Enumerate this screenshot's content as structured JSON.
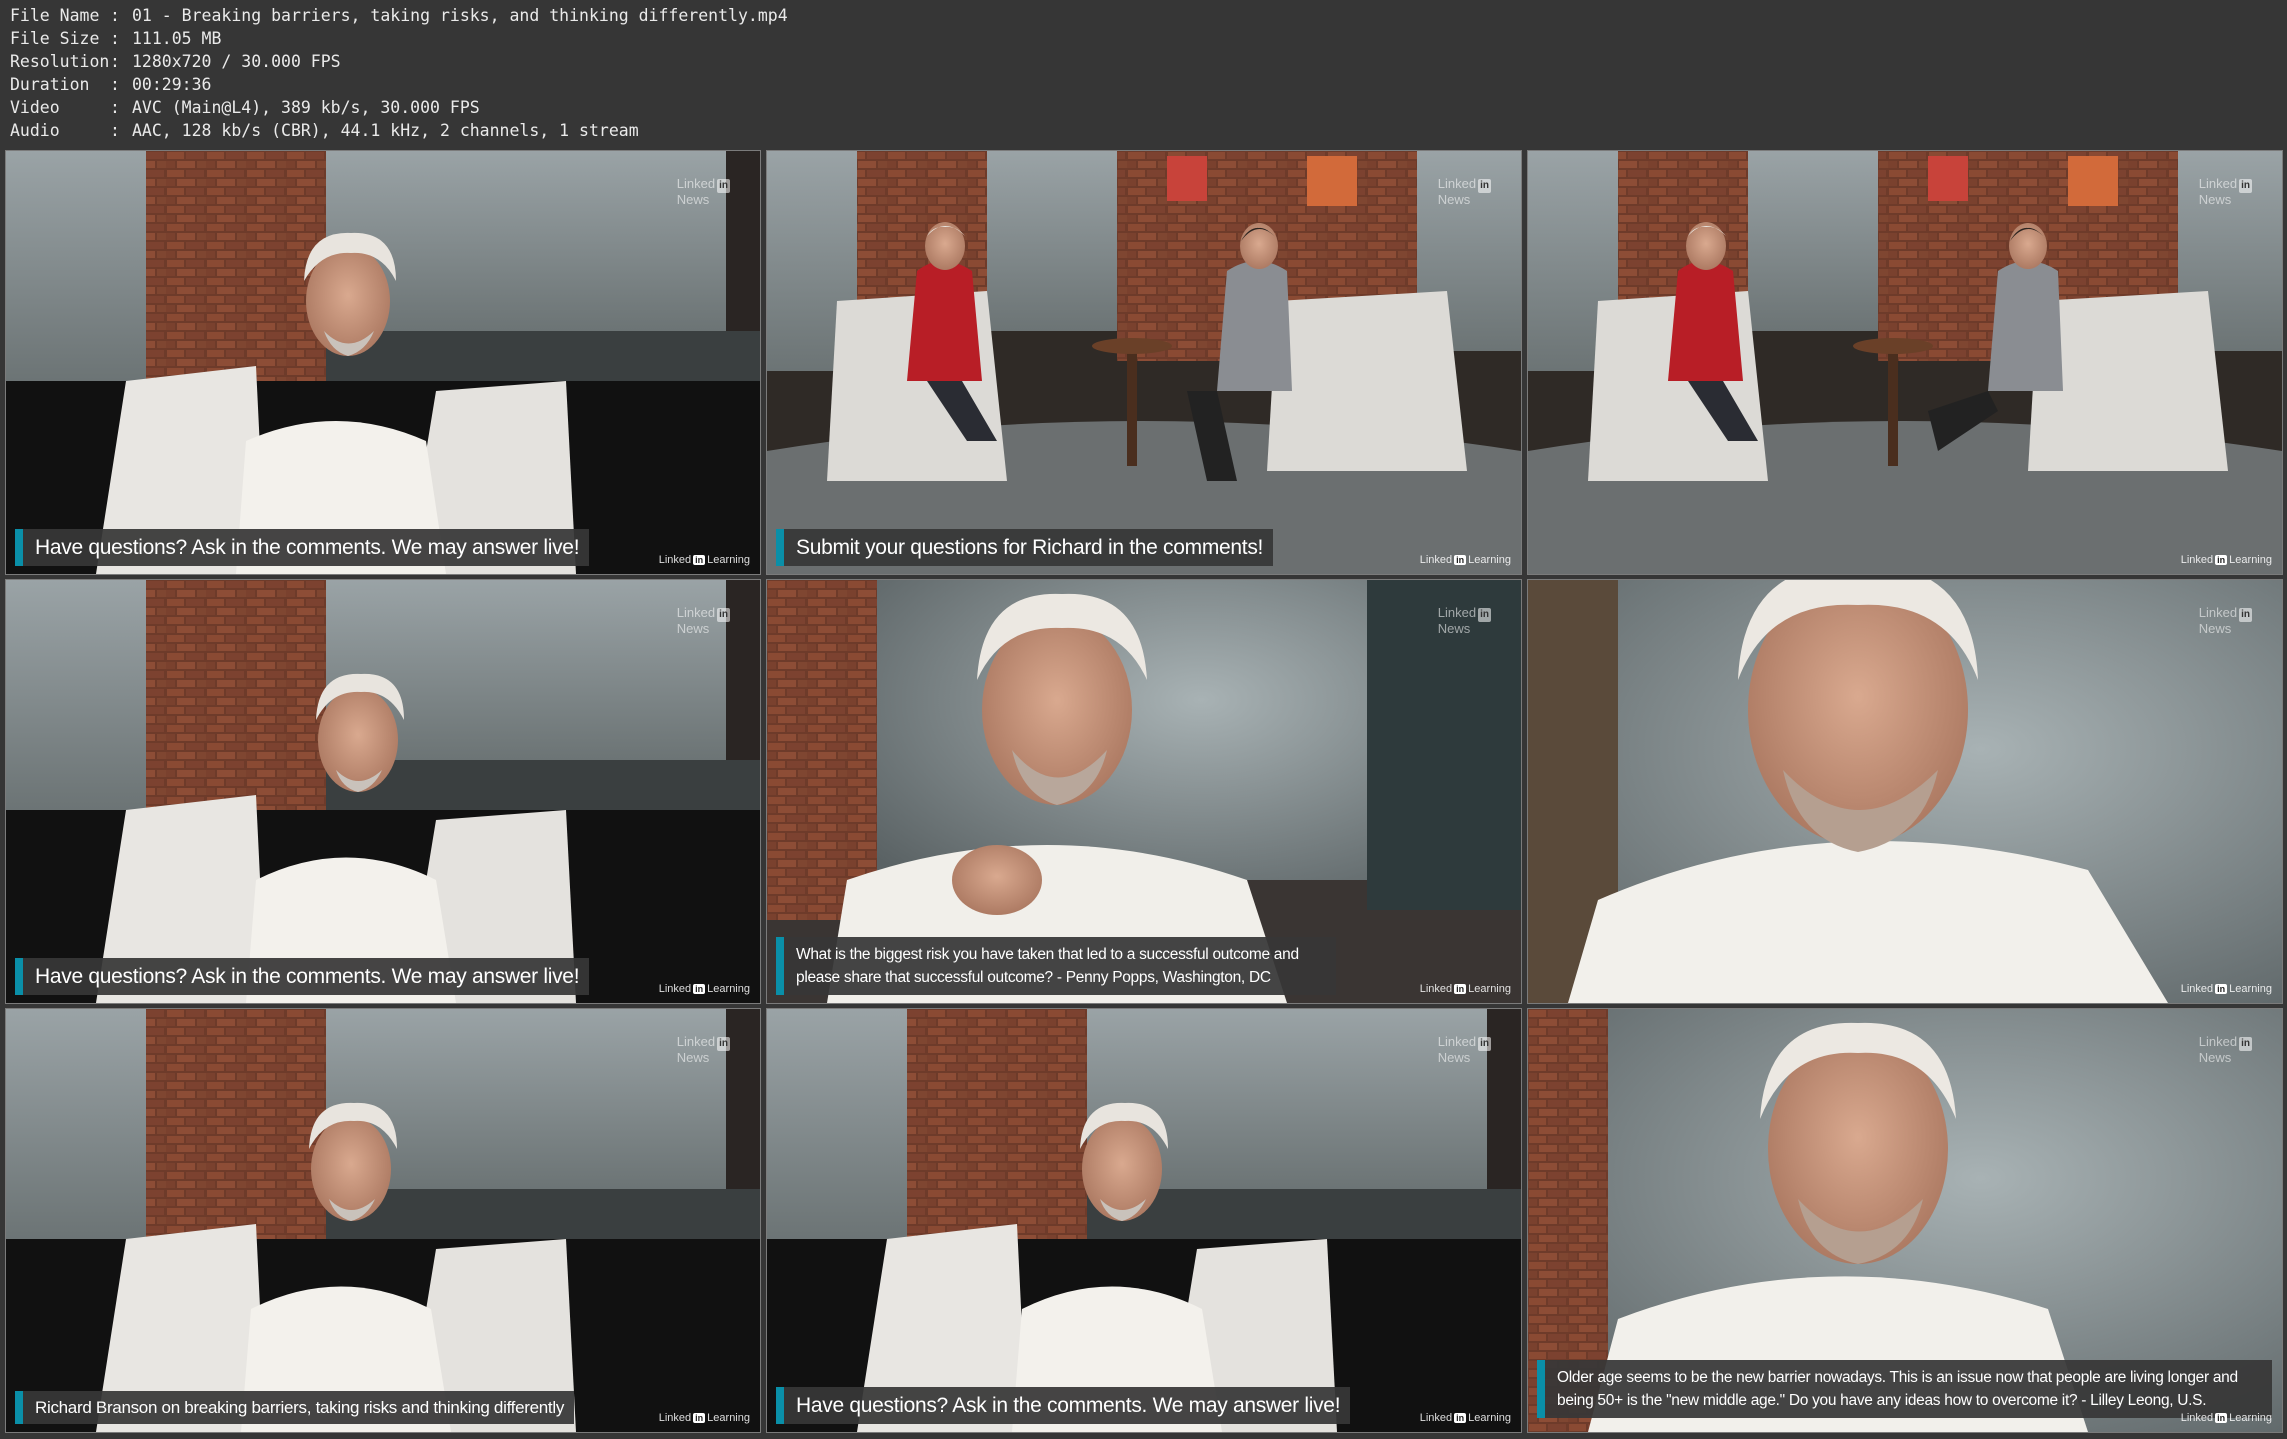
{
  "metadata": [
    {
      "key": "File Name",
      "sep": ":",
      "value": "01 - Breaking barriers, taking risks, and thinking differently.mp4"
    },
    {
      "key": "File Size",
      "sep": ":",
      "value": "111.05 MB"
    },
    {
      "key": "Resolution",
      "sep": ":",
      "value": "1280x720 / 30.000 FPS"
    },
    {
      "key": "Duration",
      "sep": ":",
      "value": "00:29:36"
    },
    {
      "key": "Video",
      "sep": ":",
      "value": "AVC (Main@L4), 389 kb/s, 30.000 FPS"
    },
    {
      "key": "Audio",
      "sep": ":",
      "value": "AAC, 128 kb/s (CBR), 44.1 kHz, 2 channels, 1 stream"
    }
  ],
  "watermarks": {
    "news_top": "Linked",
    "news_badge": "in",
    "news_bottom": "News",
    "learning_left": "Linked",
    "learning_badge": "in",
    "learning_right": "Learning"
  },
  "thumbnails": [
    {
      "caption": "Have questions? Ask in the comments. We may answer live!"
    },
    {
      "caption": "Submit your questions for Richard in the comments!"
    },
    {
      "caption": ""
    },
    {
      "caption": "Have questions? Ask in the comments. We may answer live!"
    },
    {
      "caption": "What is the biggest risk you have taken that led to a successful outcome and please share that successful outcome? - Penny Popps, Washington, DC"
    },
    {
      "caption": ""
    },
    {
      "caption": "Richard Branson on breaking barriers, taking risks and thinking differently"
    },
    {
      "caption": "Have questions? Ask in the comments. We may answer live!"
    },
    {
      "caption": "Older age seems to be the new barrier nowadays. This is an issue now that people are living longer and being 50+ is the \"new middle age.\" Do you have any ideas how to overcome it? - Lilley Leong, U.S."
    }
  ]
}
